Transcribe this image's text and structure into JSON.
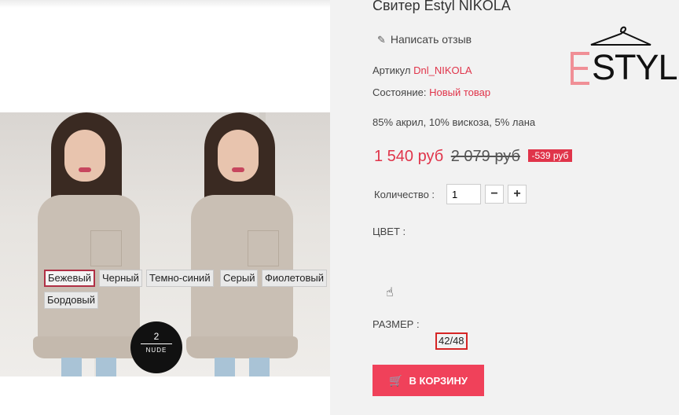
{
  "product": {
    "title": "Свитер Estyl NIKOLA",
    "review_link": "Написать отзыв",
    "sku_label": "Артикул",
    "sku_value": "Dnl_NIKOLA",
    "condition_label": "Состояние:",
    "condition_value": "Новый товар",
    "composition": "85% акрил, 10% вискоза, 5% лана"
  },
  "price": {
    "current": "1 540 руб",
    "old": "2 079 руб",
    "discount": "-539 руб"
  },
  "quantity": {
    "label": "Количество :",
    "value": "1",
    "minus": "−",
    "plus": "+"
  },
  "color": {
    "label": "ЦВЕТ :",
    "options": [
      "Бежевый",
      "Черный",
      "Темно-синий",
      "Серый",
      "Фиолетовый",
      "Бордовый"
    ],
    "selected": "Бежевый"
  },
  "size": {
    "label": "РАЗМЕР :",
    "value": "42/48"
  },
  "cart_button": "В КОРЗИНУ",
  "badge": {
    "number": "2",
    "text": "NUDE"
  },
  "logo": {
    "letter": "E",
    "text": "STYL"
  },
  "colors": {
    "accent": "#e0344a",
    "cart": "#f0415a",
    "panel_bg": "#f2f2f2",
    "active_border": "#b03045"
  }
}
